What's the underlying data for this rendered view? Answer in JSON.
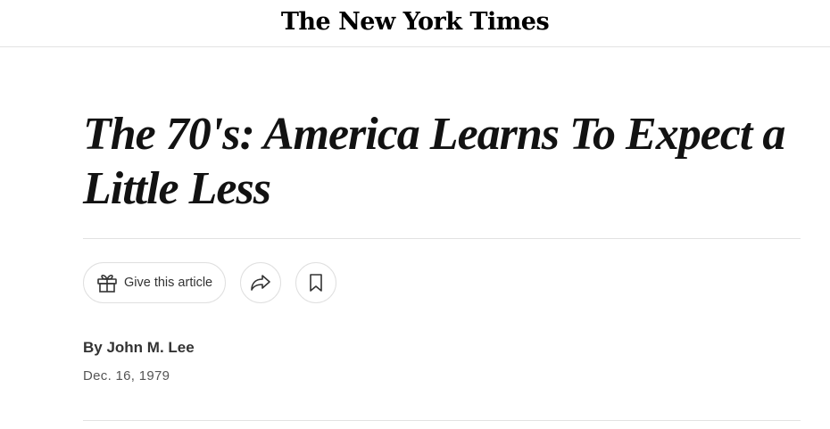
{
  "masthead": {
    "logo_text": "The New York Times"
  },
  "article": {
    "headline": "The 70's: America Learns To Expect a Little Less",
    "byline": "By John M. Lee",
    "date": "Dec. 16, 1979"
  },
  "actions": {
    "gift_label": "Give this article",
    "gift_icon": "gift-icon",
    "share_icon": "share-icon",
    "save_icon": "bookmark-icon"
  },
  "colors": {
    "text": "#121212",
    "rule": "#e2e2e2",
    "button_border": "#dfdfdf"
  }
}
